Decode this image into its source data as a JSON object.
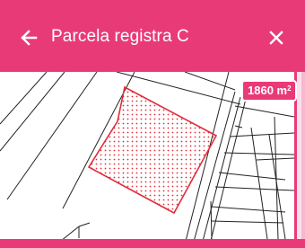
{
  "header": {
    "title": "Parcela registra C",
    "back_icon": "arrow-left-icon",
    "close_icon": "close-icon",
    "color": "#e93a78"
  },
  "map": {
    "parcel_area_value": "1860 m",
    "parcel_area_unit_sup": "2",
    "parcel_outline_color": "#e02d3c",
    "parcel_fill_pattern": "dots"
  }
}
